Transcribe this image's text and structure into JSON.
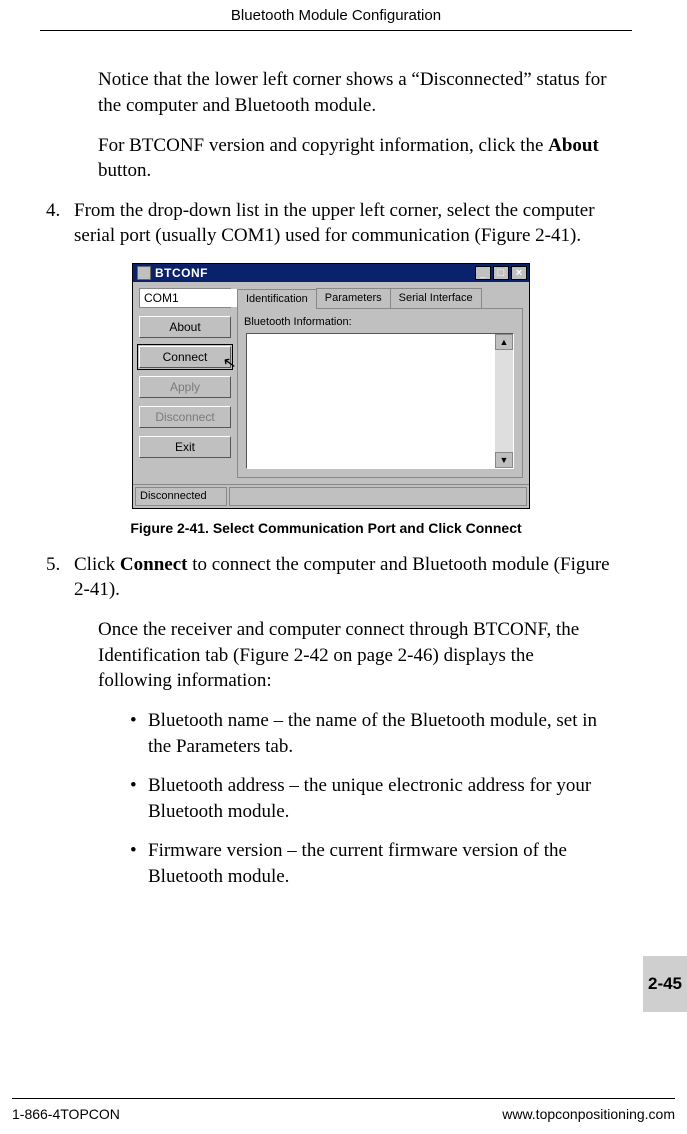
{
  "header": {
    "title": "Bluetooth Module Configuration"
  },
  "body": {
    "p1a": "Notice that the lower left corner shows a “Disconnected” status for the computer and Bluetooth module.",
    "p1b_pre": "For BTCONF version and copyright information, click the ",
    "p1b_bold": "About",
    "p1b_post": " button.",
    "step4_num": "4.",
    "step4_text": "From the drop-down list in the upper left corner, select the computer serial port (usually COM1) used for communication (Figure 2-41).",
    "fig_caption": "Figure 2-41. Select Communication Port and Click Connect",
    "step5_num": "5.",
    "step5_pre": "Click ",
    "step5_bold": "Connect",
    "step5_post": " to connect the computer and Bluetooth module (Figure 2-41).",
    "p_after5": "Once the receiver and computer connect through BTCONF, the Identification tab (Figure 2-42 on page 2-46) displays the following information:",
    "bullets": [
      "Bluetooth name – the name of the Bluetooth module, set in the Parameters tab.",
      "Bluetooth address – the unique electronic address for your Bluetooth module.",
      "Firmware version – the current firmware version of the Bluetooth module."
    ]
  },
  "win": {
    "title": "BTCONF",
    "combo_value": "COM1",
    "buttons": {
      "about": "About",
      "connect": "Connect",
      "apply": "Apply",
      "disconnect": "Disconnect",
      "exit": "Exit"
    },
    "tabs": {
      "identification": "Identification",
      "parameters": "Parameters",
      "serial": "Serial Interface"
    },
    "panel_label": "Bluetooth Information:",
    "status": "Disconnected"
  },
  "page_tab": "2-45",
  "footer": {
    "left": "1-866-4TOPCON",
    "right": "www.topconpositioning.com"
  }
}
